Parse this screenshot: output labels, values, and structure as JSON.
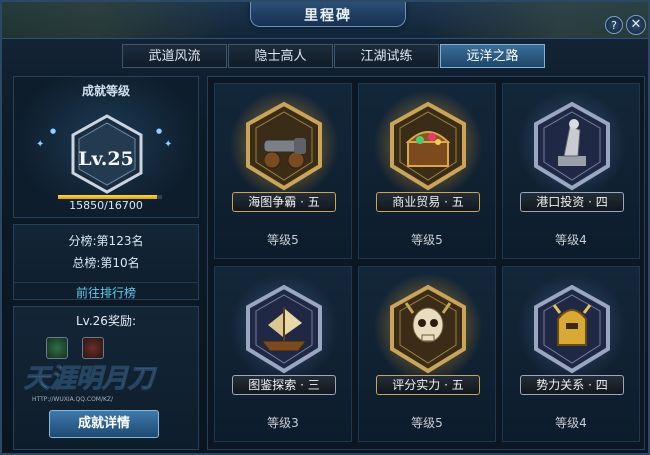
{
  "window": {
    "title": "里程碑"
  },
  "tabs": [
    {
      "label": "武道风流"
    },
    {
      "label": "隐士高人"
    },
    {
      "label": "江湖试练"
    },
    {
      "label": "远洋之路"
    }
  ],
  "active_tab": 3,
  "level_panel": {
    "header": "成就等级",
    "level": "Lv.25",
    "xp_text": "15850/16700",
    "xp_progress": 0.949
  },
  "rank_panel": {
    "sub_rank": "分榜:第123名",
    "total_rank": "总榜:第10名",
    "link": "前往排行榜"
  },
  "reward_panel": {
    "label": "Lv.26奖励:",
    "detail_button": "成就详情",
    "watermark_text": "HTTP://WUXIA.QQ.COM/KZ/"
  },
  "achievements": [
    {
      "name": "海图争霸 · 五",
      "level": "等级5",
      "tier": "gold",
      "icon": "cannon-icon"
    },
    {
      "name": "商业贸易 · 五",
      "level": "等级5",
      "tier": "gold",
      "icon": "treasure-chest-icon"
    },
    {
      "name": "港口投资 · 四",
      "level": "等级4",
      "tier": "silver",
      "icon": "anchor-statue-icon"
    },
    {
      "name": "图鉴探索 · 三",
      "level": "等级3",
      "tier": "silver",
      "icon": "ship-icon"
    },
    {
      "name": "评分实力 · 五",
      "level": "等级5",
      "tier": "gold",
      "icon": "skull-icon"
    },
    {
      "name": "势力关系 · 四",
      "level": "等级4",
      "tier": "silver",
      "icon": "helmet-icon"
    }
  ],
  "colors": {
    "gold_frame": "#c9a45b",
    "silver_frame": "#9aa7c0",
    "accent_tab": "#3a6e9a",
    "xp_bar": "#f0b51c"
  }
}
